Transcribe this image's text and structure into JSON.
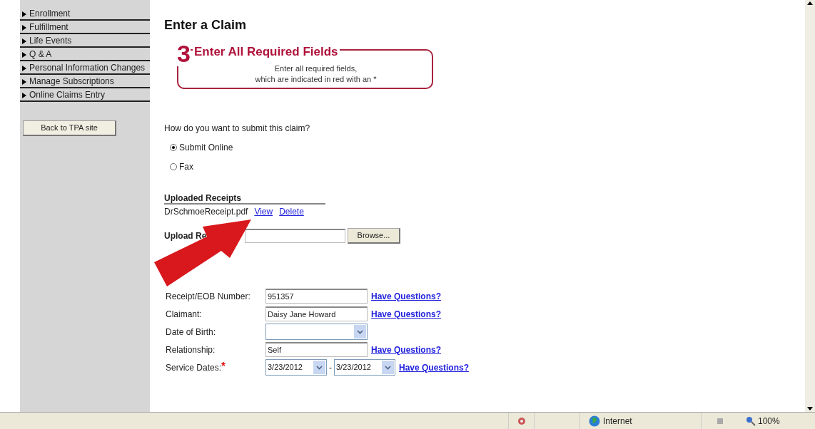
{
  "sidebar": {
    "items": [
      {
        "label": "Enrollment"
      },
      {
        "label": "Fulfillment"
      },
      {
        "label": "Life Events"
      },
      {
        "label": "Q & A"
      },
      {
        "label": "Personal Information Changes"
      },
      {
        "label": "Manage Subscriptions"
      },
      {
        "label": "Online Claims Entry"
      }
    ],
    "back_button": "Back to TPA site"
  },
  "page_title": "Enter a Claim",
  "banner": {
    "step": "3",
    "title": "Enter All Required Fields",
    "lines": [
      "Enter all required fields,",
      "which are indicated in red with an *"
    ]
  },
  "submit": {
    "question": "How do you want to submit this claim?",
    "options": [
      {
        "label": "Submit Online",
        "selected": true
      },
      {
        "label": "Fax",
        "selected": false
      }
    ]
  },
  "uploaded": {
    "heading": "Uploaded Receipts",
    "file": "DrSchmoeReceipt.pdf",
    "links": [
      "View",
      "Delete"
    ]
  },
  "upload": {
    "label": "Upload Re",
    "button": "Browse..."
  },
  "fields": [
    {
      "kind": "text",
      "label": "Receipt/EOB Number:",
      "value": "951357",
      "help": "Have Questions?"
    },
    {
      "kind": "text",
      "label": "Claimant:",
      "value": "Daisy Jane Howard",
      "help": "Have Questions?"
    },
    {
      "kind": "select",
      "label": "Date of Birth:"
    },
    {
      "kind": "text",
      "label": "Relationship:",
      "value": "Self",
      "help": "Have Questions?"
    },
    {
      "kind": "range",
      "label": "Service Dates:",
      "required_mark": "*",
      "value": "3/23/2012",
      "value2": "3/23/2012",
      "separator": "-",
      "help": "Have Questions?"
    }
  ],
  "status_bar": {
    "zone": "Internet",
    "zoom": "100%"
  }
}
